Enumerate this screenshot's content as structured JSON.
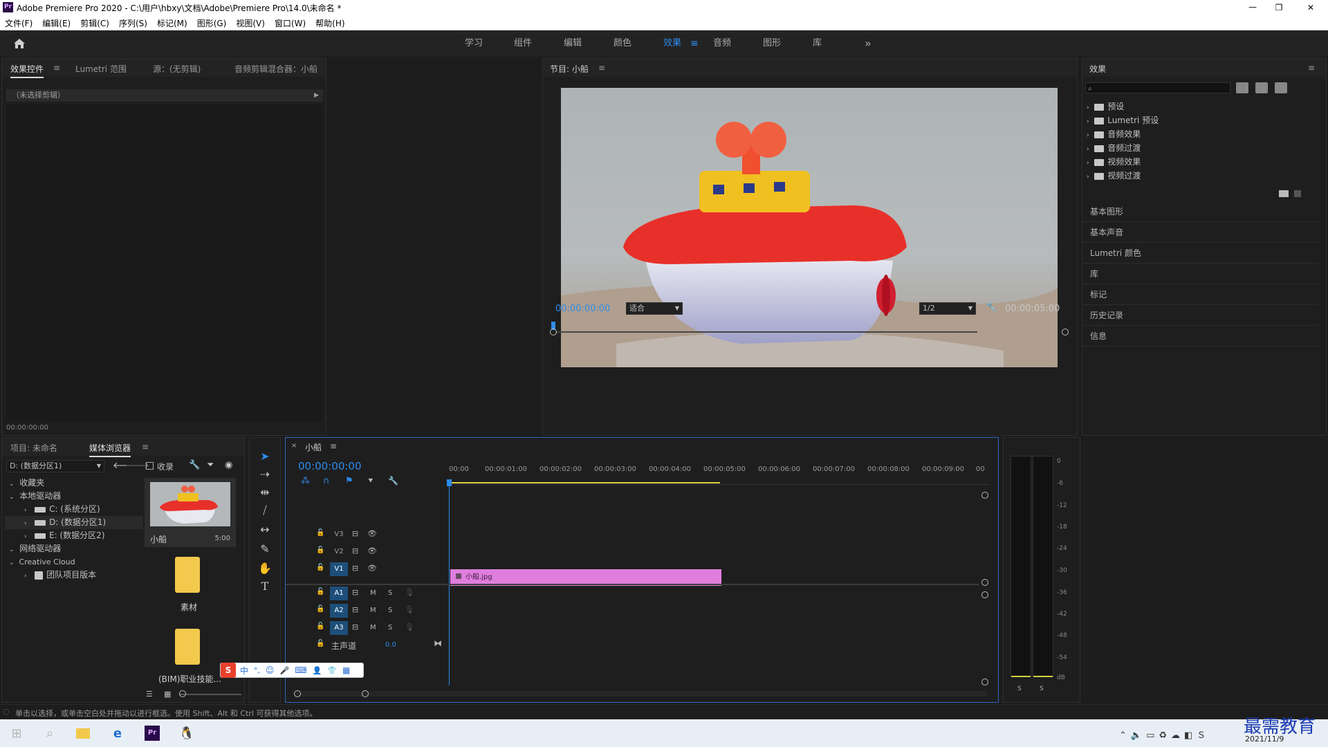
{
  "window": {
    "title": "Adobe Premiere Pro 2020 - C:\\用户\\hbxy\\文档\\Adobe\\Premiere Pro\\14.0\\未命名 *",
    "app_icon": "Pr"
  },
  "menu": [
    "文件(F)",
    "编辑(E)",
    "剪辑(C)",
    "序列(S)",
    "标记(M)",
    "图形(G)",
    "视图(V)",
    "窗口(W)",
    "帮助(H)"
  ],
  "workspaces": {
    "items": [
      "学习",
      "组件",
      "编辑",
      "颜色",
      "效果",
      "音频",
      "图形",
      "库"
    ],
    "active": "效果",
    "more": "»"
  },
  "effect_controls": {
    "tabs": [
      "效果控件",
      "Lumetri 范围",
      "源：(无剪辑)",
      "音频剪辑混合器：小船"
    ],
    "no_clip": "（未选择剪辑）",
    "timecode": "00:00:00:00"
  },
  "program": {
    "title": "节目: 小船",
    "timecode_in": "00:00:00:00",
    "fit": "适合",
    "resolution": "1/2",
    "duration": "00:00:05:00"
  },
  "effects_panel": {
    "title": "效果",
    "tree": [
      "预设",
      "Lumetri 预设",
      "音频效果",
      "音频过渡",
      "视频效果",
      "视频过渡"
    ],
    "sections": [
      "基本图形",
      "基本声音",
      "Lumetri 颜色",
      "库",
      "标记",
      "历史记录",
      "信息"
    ]
  },
  "project": {
    "tabs": [
      "项目: 未命名",
      "媒体浏览器"
    ],
    "drive": "D: (数据分区1)",
    "ingest": "收录",
    "tree": {
      "favorites": "收藏夹",
      "local": "本地驱动器",
      "drives": [
        "C: (系统分区)",
        "D: (数据分区1)",
        "E: (数据分区2)"
      ],
      "network": "网络驱动器",
      "cc": "Creative Cloud",
      "team": "团队项目版本"
    },
    "items": [
      {
        "name": "小船",
        "duration": "5:00"
      },
      {
        "name": "素材",
        "duration": ""
      },
      {
        "name": "(BIM)职业技能...",
        "duration": ""
      }
    ]
  },
  "timeline": {
    "tab": "小船",
    "timecode": "00:00:00:00",
    "ruler": [
      "00:00",
      "00:00:01:00",
      "00:00:02:00",
      "00:00:03:00",
      "00:00:04:00",
      "00:00:05:00",
      "00:00:06:00",
      "00:00:07:00",
      "00:00:08:00",
      "00:00:09:00",
      "00"
    ],
    "video_tracks": [
      "V3",
      "V2",
      "V1"
    ],
    "audio_tracks": [
      "A1",
      "A2",
      "A3"
    ],
    "master": "主声道",
    "master_value": "0.0",
    "clip_name": "小船.jpg",
    "m": "M",
    "s": "S"
  },
  "meter": {
    "labels": [
      "0",
      "-6",
      "-12",
      "-18",
      "-24",
      "-30",
      "-36",
      "-42",
      "-48",
      "-54",
      "dB"
    ],
    "solo": [
      "S",
      "S"
    ]
  },
  "status": {
    "text": "单击以选择，或单击空白处并拖动以进行框选。使用 Shift、Alt 和 Ctrl 可获得其他选项。"
  },
  "taskbar": {
    "date": "2021/11/9",
    "watermark": "最需教育"
  },
  "ime": {
    "items": [
      "中",
      "°,",
      "☺",
      "🎤",
      "⌨",
      "👤",
      "👕",
      "▦"
    ]
  },
  "colors": {
    "accent": "#2d8ceb",
    "clip": "#e07ede",
    "track_sel": "#1d4f7a",
    "timeline_border": "#2d6ac0"
  }
}
